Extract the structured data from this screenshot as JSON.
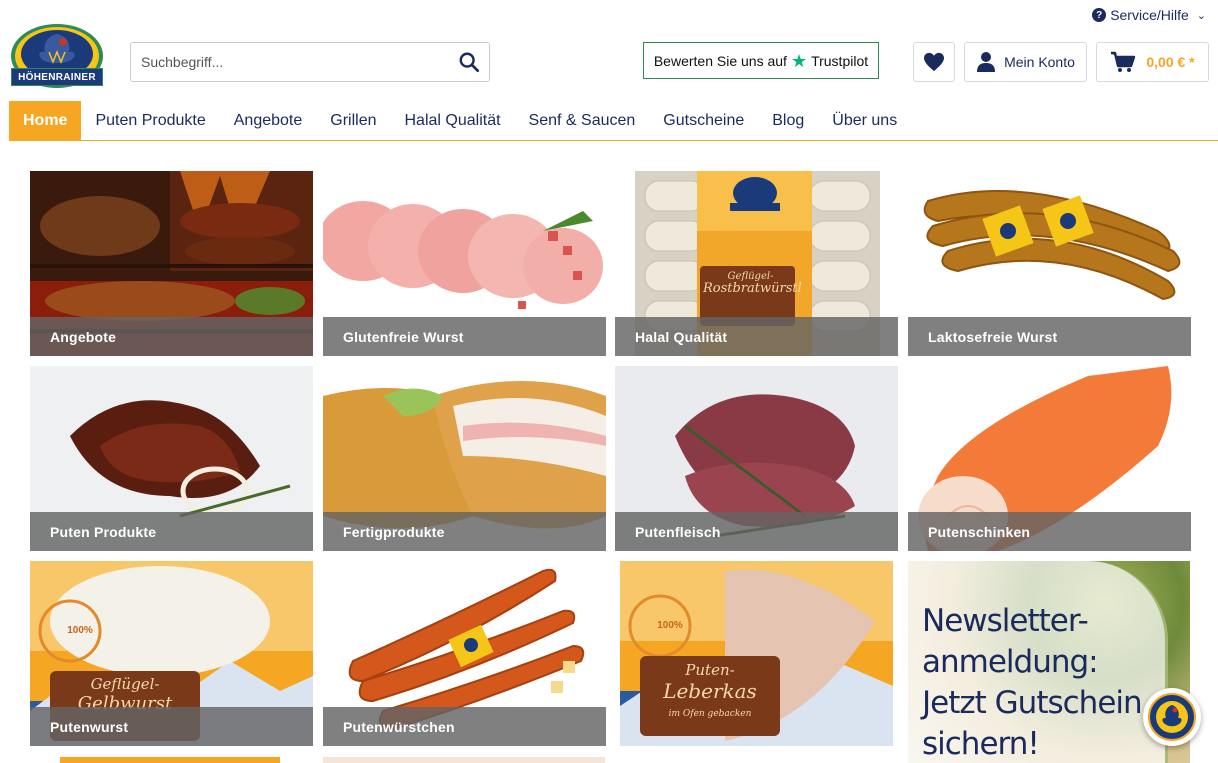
{
  "header": {
    "service_label": "Service/Hilfe",
    "logo_text": "HÖHENRAINER",
    "search_placeholder": "Suchbegriff...",
    "trustpilot_text": "Bewerten Sie uns auf",
    "trustpilot_brand": "Trustpilot",
    "account_label": "Mein Konto",
    "cart_total": "0,00 € *"
  },
  "nav": {
    "items": [
      {
        "label": "Home",
        "active": true
      },
      {
        "label": "Puten Produkte"
      },
      {
        "label": "Angebote"
      },
      {
        "label": "Grillen"
      },
      {
        "label": "Halal Qualität"
      },
      {
        "label": "Senf & Saucen"
      },
      {
        "label": "Gutscheine"
      },
      {
        "label": "Blog"
      },
      {
        "label": "Über uns"
      }
    ]
  },
  "tiles": [
    {
      "label": "Angebote"
    },
    {
      "label": "Glutenfreie Wurst"
    },
    {
      "label": "Halal Qualität"
    },
    {
      "label": "Laktosefreie Wurst"
    },
    {
      "label": "Puten Produkte"
    },
    {
      "label": "Fertigprodukte"
    },
    {
      "label": "Putenfleisch"
    },
    {
      "label": "Putenschinken"
    },
    {
      "label": "Putenwurst"
    },
    {
      "label": "Putenwürstchen"
    },
    {
      "label": "Puten-Leberkas"
    }
  ],
  "tile_art_text": {
    "halal_pack_line1": "Geflügel-",
    "halal_pack_line2": "Rostbratwürstl",
    "putenwurst_pack_line1": "Geflügel-",
    "putenwurst_pack_line2": "Gelbwurst",
    "leberkas_pack_line1": "Puten-",
    "leberkas_pack_line2": "Leberkas",
    "leberkas_pack_line3": "im Ofen gebacken",
    "badge_100": "100%"
  },
  "newsletter": {
    "line1": "Newsletter-",
    "line2": "anmeldung:",
    "line3": "Jetzt Gutschein",
    "line4": "sichern!"
  },
  "colors": {
    "brand_navy": "#1a2a5c",
    "accent_orange": "#f5a623",
    "trustpilot_green": "#00b67a"
  }
}
